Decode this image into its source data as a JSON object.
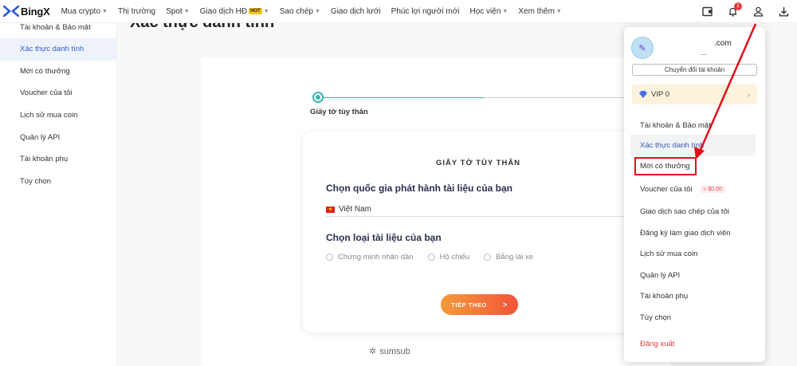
{
  "brand": {
    "name": "BingX"
  },
  "nav": {
    "items": [
      {
        "label": "Mua crypto",
        "caret": true
      },
      {
        "label": "Thị trường",
        "caret": false
      },
      {
        "label": "Spot",
        "caret": true
      },
      {
        "label": "Giao dịch HĐ",
        "caret": true,
        "badge": "HOT"
      },
      {
        "label": "Sao chép",
        "caret": true
      },
      {
        "label": "Giao dịch lưới",
        "caret": false
      },
      {
        "label": "Phúc lợi người mới",
        "caret": false
      },
      {
        "label": "Học viện",
        "caret": true
      },
      {
        "label": "Xem thêm",
        "caret": true
      }
    ],
    "icons": [
      "wallet-icon",
      "bell-icon",
      "user-icon",
      "download-icon"
    ],
    "notification_count": "1"
  },
  "sidebar": {
    "items": [
      {
        "label": "Tài khoản & Bảo mật"
      },
      {
        "label": "Xác thực danh tính",
        "active": true
      },
      {
        "label": "Mời có thưởng"
      },
      {
        "label": "Voucher của tôi"
      },
      {
        "label": "Lịch sử mua coin"
      },
      {
        "label": "Quản lý API"
      },
      {
        "label": "Tài khoản phụ"
      },
      {
        "label": "Tùy chọn"
      }
    ]
  },
  "main": {
    "page_title": "Xác thực danh tính",
    "step_label": "Giấy tờ tùy thân",
    "form": {
      "title": "GIẤY TỜ TÙY THÂN",
      "country_question": "Chọn quốc gia phát hành tài liệu của bạn",
      "country_value": "Việt Nam",
      "doc_question": "Chọn loại tài liệu của bạn",
      "doc_options": [
        "Chứng minh nhân dân",
        "Hộ chiếu",
        "Bằng lái xe"
      ],
      "next_label": "TIẾP THEO",
      "next_arrow": ">"
    },
    "powered_by": "sumsub"
  },
  "account_menu": {
    "email": ".com",
    "switch_account_label": "Chuyển đổi tài khoản",
    "vip_label": "VIP 0",
    "items": [
      {
        "label": "Tài khoản & Bảo mật"
      },
      {
        "label": "Xác thực danh tính",
        "highlighted": true
      },
      {
        "label": "Mời có thưởng"
      },
      {
        "label": "Voucher của tôi",
        "pill": "≈ $0.00"
      },
      {
        "label": "Giao dịch sao chép của tôi"
      },
      {
        "label": "Đăng ký làm giao dịch viên"
      },
      {
        "label": "Lịch sử mua coin"
      },
      {
        "label": "Quản lý API"
      },
      {
        "label": "Tài khoản phụ"
      },
      {
        "label": "Tùy chọn"
      },
      {
        "label": "Đăng xuất",
        "danger": true
      }
    ]
  },
  "colors": {
    "brand": "#2a5bd7",
    "accent_teal": "#37b9a9",
    "button_gradient_start": "#f59a3a",
    "button_gradient_end": "#f2543a",
    "annotation_red": "#e0101a"
  }
}
